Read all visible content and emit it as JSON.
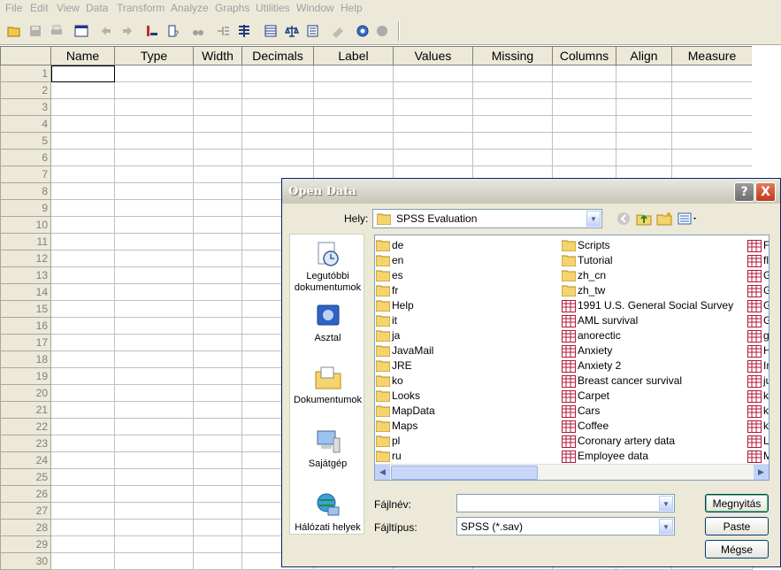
{
  "menu": [
    "File",
    "Edit",
    "View",
    "Data",
    "Transform",
    "Analyze",
    "Graphs",
    "Utilities",
    "Window",
    "Help"
  ],
  "grid": {
    "columns": [
      "Name",
      "Type",
      "Width",
      "Decimals",
      "Label",
      "Values",
      "Missing",
      "Columns",
      "Align",
      "Measure"
    ],
    "rows": [
      "1",
      "2",
      "3",
      "4",
      "5",
      "6",
      "7",
      "8",
      "9",
      "10",
      "11",
      "12",
      "13",
      "14",
      "15",
      "16",
      "17",
      "18",
      "19",
      "20",
      "21",
      "22",
      "23",
      "24",
      "25",
      "26",
      "27",
      "28",
      "29",
      "30"
    ]
  },
  "dialog": {
    "title": "Open Data",
    "help_label": "?",
    "close_label": "X",
    "look_in_label": "Hely:",
    "look_in_value": "SPSS Evaluation",
    "places": [
      "Legutóbbi dokumentumok",
      "Asztal",
      "Dokumentumok",
      "Sajátgép",
      "Hálózati helyek"
    ],
    "folders_col1": [
      "de",
      "en",
      "es",
      "fr",
      "Help",
      "it",
      "ja",
      "JavaMail",
      "JRE",
      "ko",
      "Looks",
      "MapData",
      "Maps",
      "pl",
      "ru"
    ],
    "col2_folders": [
      "Scripts",
      "Tutorial",
      "zh_cn",
      "zh_tw"
    ],
    "col2_files": [
      "1991 U.S. General Social Survey",
      "AML survival",
      "anorectic",
      "Anxiety",
      "Anxiety 2",
      "Breast cancer survival",
      "Carpet",
      "Cars",
      "Coffee",
      "Coronary artery data",
      "Employee data"
    ],
    "col3_files": [
      "Fa",
      "flu",
      "Gl",
      "Gu",
      "GS",
      "GS",
      "gu",
      "He",
      "In",
      "ju",
      "kir",
      "kir",
      "kir",
      "Lo",
      "M"
    ],
    "filename_label": "Fájlnév:",
    "filename_value": "",
    "filetype_label": "Fájltípus:",
    "filetype_value": "SPSS (*.sav)",
    "open_button": "Megnyitás",
    "paste_button": "Paste",
    "cancel_button": "Mégse"
  },
  "colors": {
    "accent": "#0a246a",
    "file_icon": "#b0163a",
    "folder": "#f5d46e"
  }
}
